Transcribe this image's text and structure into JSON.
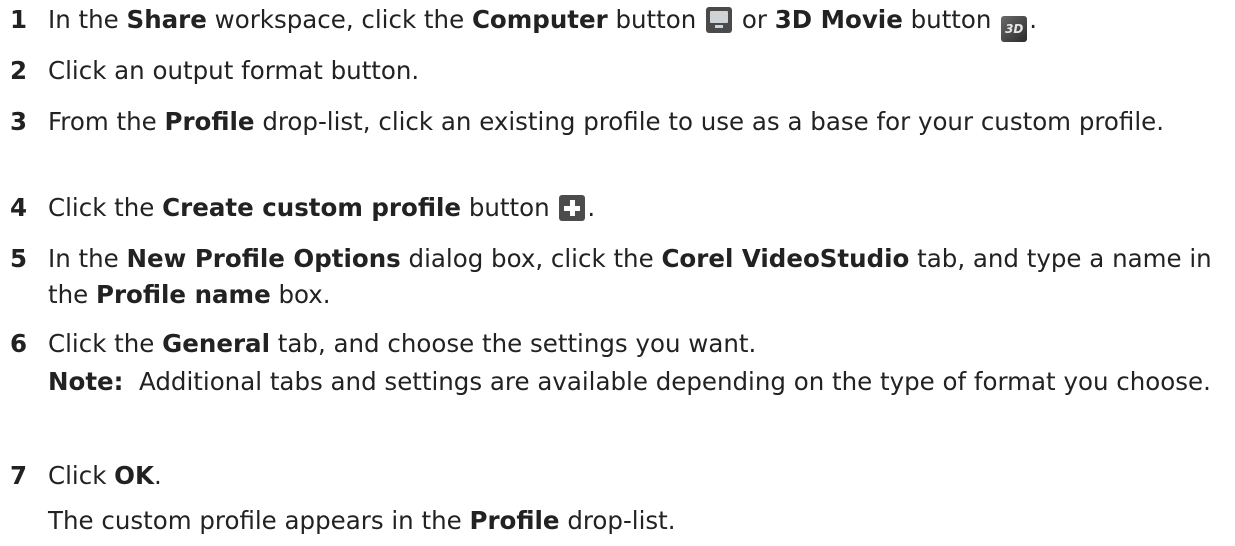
{
  "steps": [
    {
      "number": "1",
      "p1": "In the ",
      "b1": "Share",
      "p2": " workspace, click the ",
      "b2": "Computer",
      "p3": " button ",
      "p4": " or ",
      "b3": "3D Movie",
      "p5": " button ",
      "p6": ".",
      "icon_3d_text": "3D",
      "icons": [
        "computer-icon",
        "3d-movie-icon"
      ]
    },
    {
      "number": "2",
      "text": "Click an output format button."
    },
    {
      "number": "3",
      "p1": "From the ",
      "b1": "Profile",
      "p2": " drop-list, click an existing profile to use as a base for your custom profile."
    },
    {
      "number": "4",
      "p1": "Click the ",
      "b1": "Create custom profile",
      "p2": " button ",
      "p3": ".",
      "icons": [
        "plus-icon"
      ]
    },
    {
      "number": "5",
      "p1": "In the ",
      "b1": "New Profile Options",
      "p2": " dialog box, click the ",
      "b2": "Corel VideoStudio",
      "p3": " tab, and type a name in the ",
      "b3": "Profile name",
      "p4": " box."
    },
    {
      "number": "6",
      "p1": "Click the ",
      "b1": "General",
      "p2": " tab, and choose the settings you want.",
      "note_label": "Note:",
      "note_text": "  Additional tabs and settings are available depending on the type of format you choose."
    },
    {
      "number": "7",
      "p1": "Click ",
      "b1": "OK",
      "p2": ".",
      "result_p1": "The custom profile appears in the ",
      "result_b1": "Profile",
      "result_p2": " drop-list."
    }
  ],
  "colors": {
    "text": "#222222",
    "icon_dark": "#4a4a4a",
    "icon_light": "#cfd3d6"
  }
}
